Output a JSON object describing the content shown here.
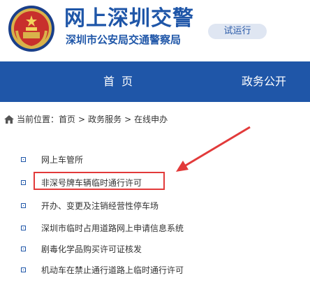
{
  "header": {
    "site_title": "网上深圳交警",
    "site_subtitle": "深圳市公安局交通警察局",
    "trial_badge": "试运行"
  },
  "nav": {
    "home": "首页",
    "gov_affairs": "政务公开"
  },
  "breadcrumb": {
    "prefix": "当前位置：",
    "items": [
      "首页",
      "政务服务",
      "在线申办"
    ],
    "separator": ">"
  },
  "services": [
    {
      "label": "网上车管所"
    },
    {
      "label": "非深号牌车辆临时通行许可",
      "highlighted": true
    },
    {
      "label": "开办、变更及注销经营性停车场"
    },
    {
      "label": "深圳市临时占用道路网上申请信息系统"
    },
    {
      "label": "剧毒化学品购买许可证核发"
    },
    {
      "label": "机动车在禁止通行道路上临时通行许可"
    }
  ],
  "colors": {
    "brand_blue": "#1f56a8",
    "highlight_red": "#e23a3a",
    "text_dark": "#333333"
  },
  "icons": {
    "emblem": "police-emblem-icon",
    "home": "home-icon",
    "bullet": "square-bullet-icon",
    "annotation": "red-arrow-icon"
  }
}
